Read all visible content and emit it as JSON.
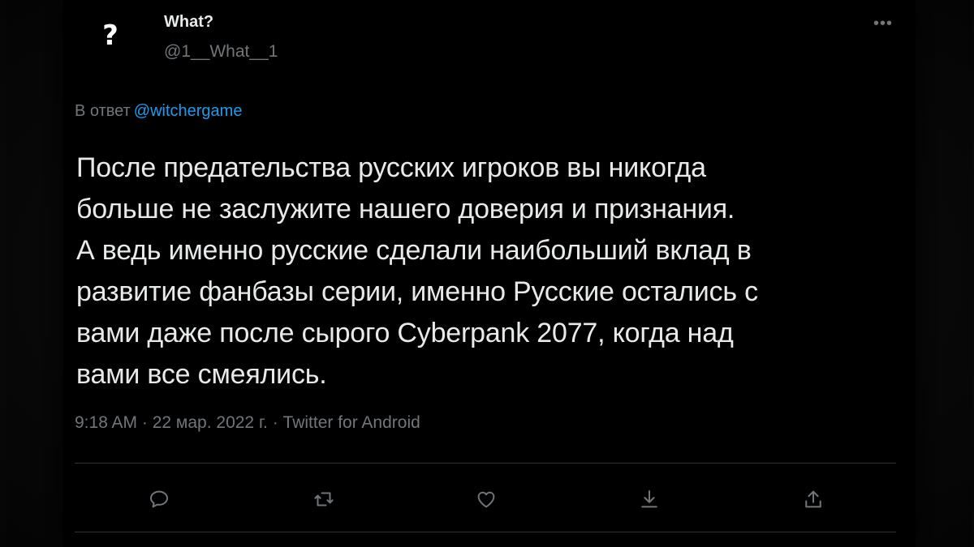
{
  "user": {
    "avatar_glyph": "?",
    "display_name": "What?",
    "handle": "@1__What__1"
  },
  "reply": {
    "prefix": "В ответ",
    "mention": "@witchergame"
  },
  "tweet": {
    "lines": [
      "После предательства русских игроков вы никогда",
      "больше не заслужите нашего доверия и признания.",
      "А ведь именно русские сделали наибольший вклад в",
      "развитие фанбазы серии, именно Русские остались с",
      "вами даже после сырого Cyberpank 2077, когда над",
      "вами все смеялись."
    ]
  },
  "meta": {
    "time": "9:18 AM",
    "separator": " · ",
    "date": "22 мар. 2022 г.",
    "source": "Twitter for Android"
  },
  "icons": {
    "more": "more-icon",
    "reply": "reply-icon",
    "retweet": "retweet-icon",
    "like": "heart-icon",
    "bookmark": "bookmark-icon",
    "share": "share-icon"
  },
  "colors": {
    "background": "#000000",
    "text": "#e7e9ea",
    "secondary": "#71767b",
    "link": "#1d9bf0",
    "divider": "#2f3336"
  }
}
